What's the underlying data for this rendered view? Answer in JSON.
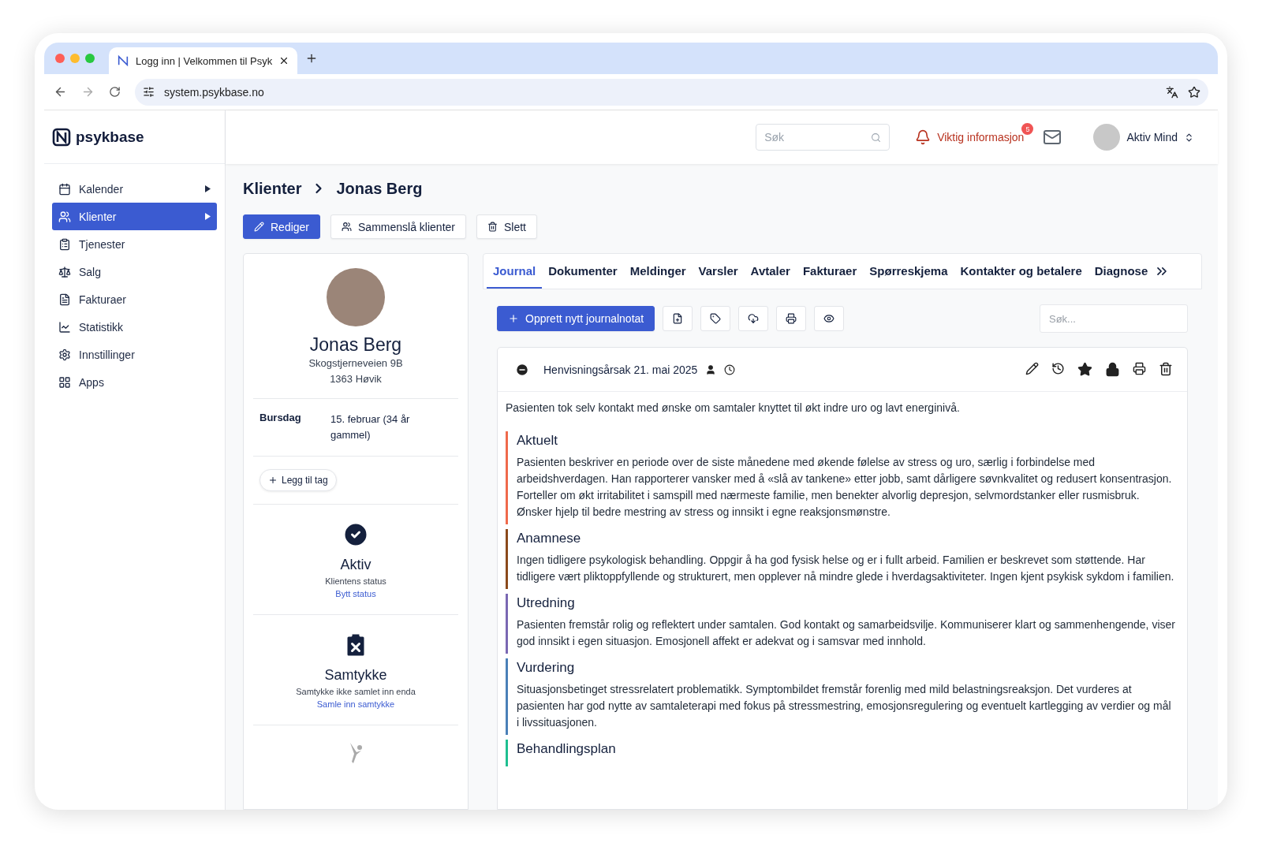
{
  "browser": {
    "tab_title": "Logg inn | Velkommen til Psyk",
    "url": "system.psykbase.no"
  },
  "logo": "psykbase",
  "header": {
    "search_placeholder": "Søk",
    "notice": "Viktig informasjon",
    "notice_badge": "5",
    "user": "Aktiv Mind"
  },
  "sidebar": {
    "items": [
      {
        "label": "Kalender",
        "selected": false,
        "has_submenu": true
      },
      {
        "label": "Klienter",
        "selected": true,
        "has_submenu": true
      },
      {
        "label": "Tjenester",
        "selected": false,
        "has_submenu": false
      },
      {
        "label": "Salg",
        "selected": false,
        "has_submenu": false
      },
      {
        "label": "Fakturaer",
        "selected": false,
        "has_submenu": false
      },
      {
        "label": "Statistikk",
        "selected": false,
        "has_submenu": false
      },
      {
        "label": "Innstillinger",
        "selected": false,
        "has_submenu": false
      },
      {
        "label": "Apps",
        "selected": false,
        "has_submenu": false
      }
    ]
  },
  "breadcrumb": [
    "Klienter",
    "Jonas Berg"
  ],
  "actions": [
    {
      "label": "Rediger",
      "kind": "primary"
    },
    {
      "label": "Sammenslå klienter",
      "kind": "merge"
    },
    {
      "label": "Slett",
      "kind": "delete"
    }
  ],
  "client": {
    "name": "Jonas Berg",
    "address": [
      "Skogstjerneveien 9B",
      "1363 Høvik"
    ],
    "birthday_label": "Bursdag",
    "birthday": "15. februar (34 år gammel)",
    "tag_button": "Legg til tag",
    "blocks": [
      {
        "kind": "check",
        "title": "Aktiv",
        "subtitle": "Klientens status",
        "link": "Bytt status"
      },
      {
        "kind": "alert",
        "title": "Samtykke",
        "subtitle": "Samtykke ikke samlet inn enda",
        "link": "Samle inn samtykke"
      }
    ]
  },
  "tabs": [
    {
      "label": "Journal",
      "selected": true
    },
    {
      "label": "Dokumenter",
      "selected": false
    },
    {
      "label": "Meldinger",
      "selected": false
    },
    {
      "label": "Varsler",
      "selected": false
    },
    {
      "label": "Avtaler",
      "selected": false
    },
    {
      "label": "Fakturaer",
      "selected": false
    },
    {
      "label": "Spørreskjema",
      "selected": false
    },
    {
      "label": "Kontakter og betalere",
      "selected": false
    },
    {
      "label": "Diagnose",
      "selected": false
    }
  ],
  "journal": {
    "new_button": "Opprett nytt journalnotat",
    "search_placeholder": "Søk...",
    "entry": {
      "title": "Henvisningsårsak 21. mai 2025",
      "intro": "Pasienten tok selv kontakt med ønske om samtaler knyttet til økt indre uro og lavt energinivå.",
      "sections": [
        {
          "heading": "Aktuelt",
          "color": "#ef6a4c",
          "text": "Pasienten beskriver en periode over de siste månedene med økende følelse av stress og uro, særlig i forbindelse med arbeidshverdagen. Han rapporterer vansker med å «slå av tankene» etter jobb, samt dårligere søvnkvalitet og redusert konsentrasjon. Forteller om økt irritabilitet i samspill med nærmeste familie, men benekter alvorlig depresjon, selvmordstanker eller rusmisbruk. Ønsker hjelp til bedre mestring av stress og innsikt i egne reaksjonsmønstre."
        },
        {
          "heading": "Anamnese",
          "color": "#8b4a1c",
          "text": "Ingen tidligere psykologisk behandling. Oppgir å ha god fysisk helse og er i fullt arbeid. Familien er beskrevet som støttende. Har tidligere vært pliktoppfyllende og strukturert, men opplever nå mindre glede i hverdagsaktiviteter. Ingen kjent psykisk sykdom i familien."
        },
        {
          "heading": "Utredning",
          "color": "#7a68b3",
          "text": "Pasienten fremstår rolig og reflektert under samtalen. God kontakt og samarbeidsvilje. Kommuniserer klart og sammenhengende, viser god innsikt i egen situasjon. Emosjonell affekt er adekvat og i samsvar med innhold."
        },
        {
          "heading": "Vurdering",
          "color": "#4a80b8",
          "text": "Situasjonsbetinget stressrelatert problematikk. Symptombildet fremstår forenlig med mild belastningsreaksjon. Det vurderes at pasienten har god nytte av samtaleterapi med fokus på stressmestring, emosjonsregulering og eventuelt kartlegging av verdier og mål i livssituasjonen."
        },
        {
          "heading": "Behandlingsplan",
          "color": "#1fbf90"
        }
      ]
    }
  }
}
